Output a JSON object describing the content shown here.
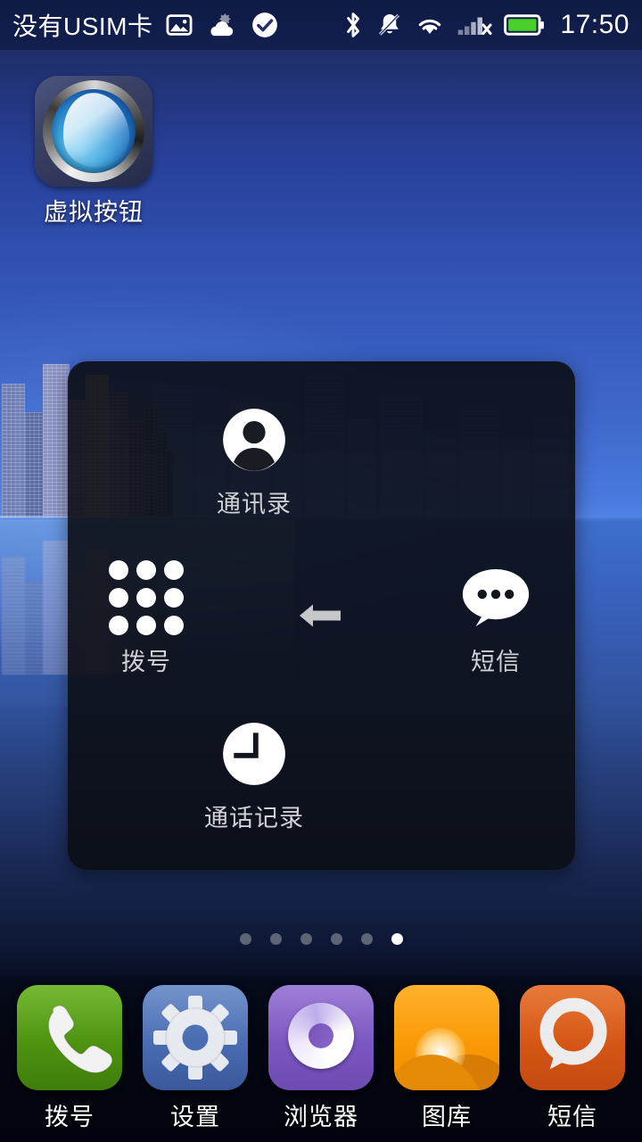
{
  "status_bar": {
    "carrier_text": "没有USIM卡",
    "clock": "17:50",
    "left_icons": [
      "screenshot-image-icon",
      "weather-cloud-sun-icon",
      "check-circle-icon"
    ],
    "right_icons": [
      "bluetooth-icon",
      "mute-bell-icon",
      "wifi-icon",
      "signal-no-service-icon",
      "battery-icon"
    ],
    "battery_color": "#4ad02a"
  },
  "home": {
    "app_icon": {
      "label": "虚拟按钮",
      "icon_name": "virtual-button-orb-icon"
    }
  },
  "overlay_panel": {
    "background_color": "#0b0d14",
    "center": {
      "icon_name": "back-arrow-icon",
      "color": "#c8c8c8"
    },
    "shortcuts": [
      {
        "label": "通讯录",
        "icon_name": "contacts-person-icon",
        "position": "top"
      },
      {
        "label": "拨号",
        "icon_name": "dialpad-grid-icon",
        "position": "left"
      },
      {
        "label": "短信",
        "icon_name": "sms-bubble-icon",
        "position": "right"
      },
      {
        "label": "通话记录",
        "icon_name": "call-log-clock-icon",
        "position": "bottom"
      }
    ]
  },
  "page_indicator": {
    "total": 6,
    "active_index": 5
  },
  "dock": {
    "items": [
      {
        "label": "拨号",
        "icon_name": "phone-handset-icon",
        "color": "#4d9310"
      },
      {
        "label": "设置",
        "icon_name": "gear-icon",
        "color": "#4a6cb2"
      },
      {
        "label": "浏览器",
        "icon_name": "browser-spiral-icon",
        "color": "#7b57c2"
      },
      {
        "label": "图库",
        "icon_name": "gallery-sunrise-icon",
        "color": "#fa9b06"
      },
      {
        "label": "短信",
        "icon_name": "sms-bubble-icon",
        "color": "#d55615"
      }
    ]
  }
}
